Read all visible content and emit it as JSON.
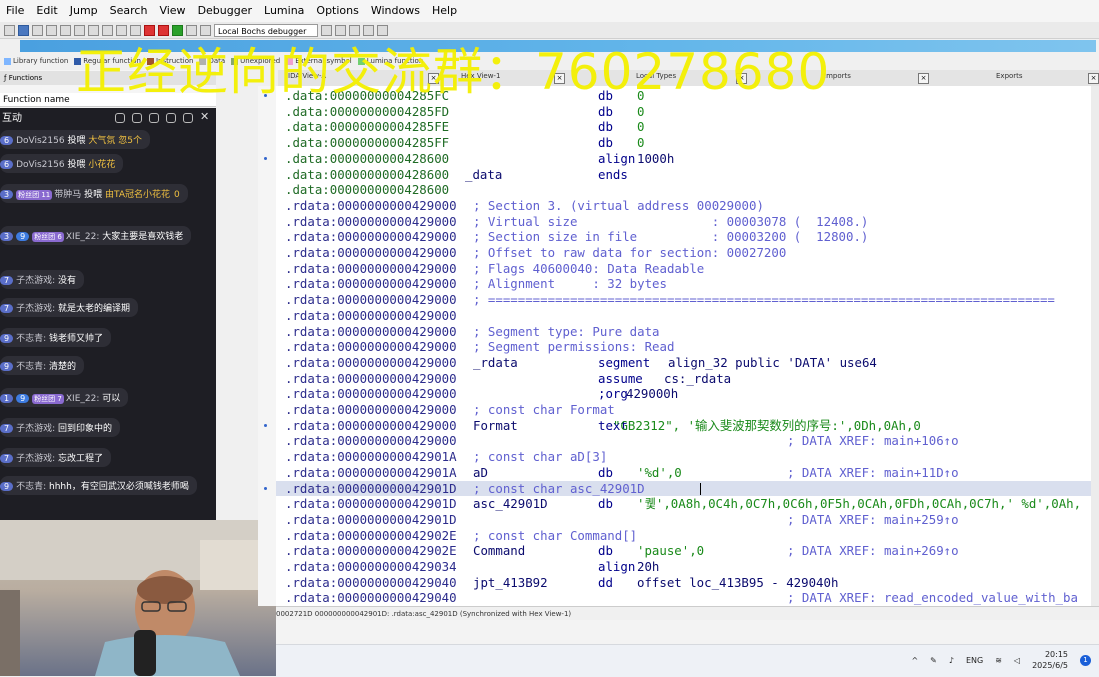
{
  "menu": [
    "File",
    "Edit",
    "Jump",
    "Search",
    "View",
    "Debugger",
    "Lumina",
    "Options",
    "Windows",
    "Help"
  ],
  "toolbar": {
    "debugger_select": "Local Bochs debugger"
  },
  "legend": [
    "Library function",
    "Regular function",
    "Instruction",
    "Data",
    "Unexplored",
    "External symbol",
    "Lumina function"
  ],
  "left_panel": {
    "title": "Functions",
    "function_name_header": "Function name"
  },
  "tabs": [
    "IDA View-A",
    "Hex View-1",
    "Local Types",
    "Imports",
    "Exports"
  ],
  "chat": {
    "title": "互动",
    "messages": [
      {
        "level": "6",
        "name": "DoVis2156",
        "text": "投喂",
        "gift": "大气氛 忽5个"
      },
      {
        "level": "6",
        "name": "DoVis2156",
        "text": "投喂",
        "gift": "小花花"
      },
      {
        "level": "3",
        "fan": "粉丝团 11",
        "name": "带肿马",
        "text": "投喂",
        "gift": "由TA冠名小花花",
        "extra": "0"
      },
      {
        "level": "3",
        "fan": "粉丝团 6",
        "vip": "9",
        "name": "XIE_22:",
        "text": "大家主要是喜欢钱老"
      },
      {
        "level": "7",
        "name": "子杰游戏:",
        "text": "没有"
      },
      {
        "level": "7",
        "name": "子杰游戏:",
        "text": "就是太老的编译期"
      },
      {
        "level": "9",
        "name": "不志青:",
        "text": "钱老师又帅了"
      },
      {
        "level": "9",
        "name": "不志青:",
        "text": "清楚的"
      },
      {
        "level": "1",
        "fan": "粉丝团 7",
        "vip": "9",
        "name": "XIE_22:",
        "text": "可以"
      },
      {
        "level": "7",
        "name": "子杰游戏:",
        "text": "回到印象中的"
      },
      {
        "level": "7",
        "name": "子杰游戏:",
        "text": "忘改工程了"
      },
      {
        "level": "9",
        "name": "不志青:",
        "text": "hhhh，有空回武汉必须喊钱老师喝"
      }
    ]
  },
  "watermark": "正经逆向的交流群：760278680",
  "code_lines": [
    {
      "addr": ".data:00000000004285FC",
      "seg": "data",
      "name": "",
      "op": "db",
      "args": "0",
      "comment": ""
    },
    {
      "addr": ".data:00000000004285FD",
      "seg": "data",
      "name": "",
      "op": "db",
      "args": "0",
      "comment": ""
    },
    {
      "addr": ".data:00000000004285FE",
      "seg": "data",
      "name": "",
      "op": "db",
      "args": "0",
      "comment": ""
    },
    {
      "addr": ".data:00000000004285FF",
      "seg": "data",
      "name": "",
      "op": "db",
      "args": "0",
      "comment": ""
    },
    {
      "addr": ".data:0000000000428600",
      "seg": "data",
      "name": "",
      "op": "align",
      "args": "1000h",
      "comment": ""
    },
    {
      "addr": ".data:0000000000428600",
      "seg": "data",
      "name": "_data",
      "op": "ends",
      "args": "",
      "comment": ""
    },
    {
      "addr": ".data:0000000000428600",
      "seg": "data",
      "name": "",
      "op": "",
      "args": "",
      "comment": ""
    },
    {
      "addr": ".rdata:0000000000429000",
      "seg": "rdata",
      "text": "; Section 3. (virtual address 00029000)"
    },
    {
      "addr": ".rdata:0000000000429000",
      "seg": "rdata",
      "text": "; Virtual size                  : 00003078 (  12408.)"
    },
    {
      "addr": ".rdata:0000000000429000",
      "seg": "rdata",
      "text": "; Section size in file          : 00003200 (  12800.)"
    },
    {
      "addr": ".rdata:0000000000429000",
      "seg": "rdata",
      "text": "; Offset to raw data for section: 00027200"
    },
    {
      "addr": ".rdata:0000000000429000",
      "seg": "rdata",
      "text": "; Flags 40600040: Data Readable"
    },
    {
      "addr": ".rdata:0000000000429000",
      "seg": "rdata",
      "text": "; Alignment     : 32 bytes"
    },
    {
      "addr": ".rdata:0000000000429000",
      "seg": "rdata",
      "text": "; ============================================================================"
    },
    {
      "addr": ".rdata:0000000000429000",
      "seg": "rdata",
      "text": ""
    },
    {
      "addr": ".rdata:0000000000429000",
      "seg": "rdata",
      "text": "; Segment type: Pure data"
    },
    {
      "addr": ".rdata:0000000000429000",
      "seg": "rdata",
      "text": "; Segment permissions: Read"
    },
    {
      "addr": ".rdata:0000000000429000",
      "seg": "rdata",
      "name": "_rdata",
      "op": "segment",
      "args": "align_32 public 'DATA' use64",
      "comment": ""
    },
    {
      "addr": ".rdata:0000000000429000",
      "seg": "rdata",
      "name": "",
      "op": "assume",
      "args": "cs:_rdata",
      "comment": ""
    },
    {
      "addr": ".rdata:0000000000429000",
      "seg": "rdata",
      "name": "",
      "op": ";org",
      "args": "429000h",
      "comment": ""
    },
    {
      "addr": ".rdata:0000000000429000",
      "seg": "rdata",
      "text": "; const char Format"
    },
    {
      "addr": ".rdata:0000000000429000",
      "seg": "rdata",
      "name": "Format",
      "op": "text",
      "args": "\"GB2312\", '输入斐波那契数列的序号:',0Dh,0Ah,0",
      "comment": ""
    },
    {
      "addr": ".rdata:0000000000429000",
      "seg": "rdata",
      "name": "",
      "op": "",
      "args": "",
      "comment": "; DATA XREF: main+106↑o"
    },
    {
      "addr": ".rdata:000000000042901A",
      "seg": "rdata",
      "text": "; const char aD[3]"
    },
    {
      "addr": ".rdata:000000000042901A",
      "seg": "rdata",
      "name": "aD",
      "op": "db",
      "args": "'%d',0",
      "comment": "; DATA XREF: main+11D↑o"
    },
    {
      "addr": ".rdata:000000000042901D",
      "seg": "rdata",
      "text": "; const char asc_42901D",
      "selected": true
    },
    {
      "addr": ".rdata:000000000042901D",
      "seg": "rdata",
      "name": "asc_42901D",
      "op": "db",
      "args": "'퀯',0A8h,0C4h,0C7h,0C6h,0F5h,0CAh,0FDh,0CAh,0C7h,' %d',0Ah,",
      "comment": ""
    },
    {
      "addr": ".rdata:000000000042901D",
      "seg": "rdata",
      "name": "",
      "op": "",
      "args": "",
      "comment": "; DATA XREF: main+259↑o"
    },
    {
      "addr": ".rdata:000000000042902E",
      "seg": "rdata",
      "text": "; const char Command[]"
    },
    {
      "addr": ".rdata:000000000042902E",
      "seg": "rdata",
      "name": "Command",
      "op": "db",
      "args": "'pause',0",
      "comment": "; DATA XREF: main+269↑o"
    },
    {
      "addr": ".rdata:0000000000429034",
      "seg": "rdata",
      "name": "",
      "op": "align",
      "args": "20h",
      "comment": ""
    },
    {
      "addr": ".rdata:0000000000429040",
      "seg": "rdata",
      "name": "jpt_413B92",
      "op": "dd",
      "args": "offset loc_413B95 - 429040h",
      "comment": ""
    },
    {
      "addr": ".rdata:0000000000429040",
      "seg": "rdata",
      "name": "",
      "op": "",
      "args": "",
      "comment": "; DATA XREF: read_encoded_value_with_ba"
    }
  ],
  "status_bar": "0002721D 000000000042901D: .rdata:asc_42901D (Synchronized with Hex View-1)",
  "taskbar": {
    "lang": "ENG",
    "time": "20:15",
    "date": "2025/6/5",
    "notifications": "1"
  }
}
